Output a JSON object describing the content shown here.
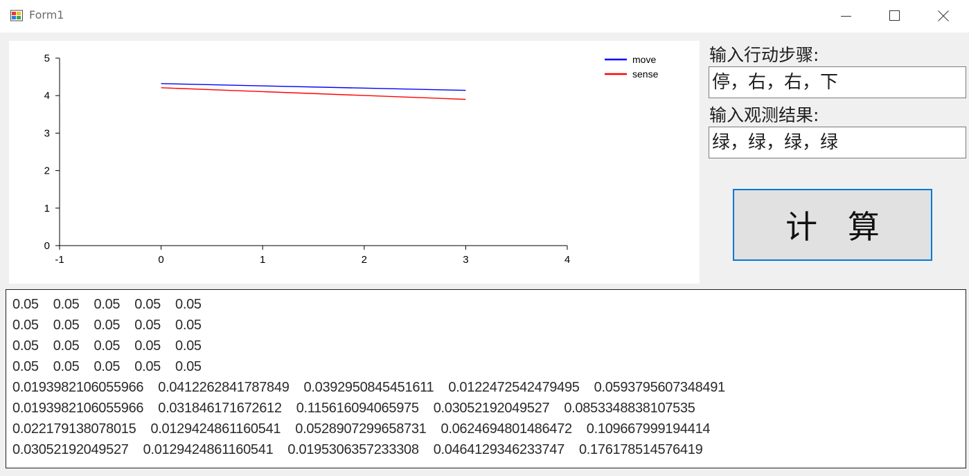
{
  "window": {
    "title": "Form1"
  },
  "labels": {
    "actions_label": "输入行动步骤:",
    "observations_label": "输入观测结果:"
  },
  "inputs": {
    "actions_value": "停，右，右，下",
    "observations_value": "绿，绿，绿，绿"
  },
  "buttons": {
    "calculate_label": "计   算"
  },
  "output_lines": [
    "0.05    0.05    0.05    0.05    0.05",
    "0.05    0.05    0.05    0.05    0.05",
    "0.05    0.05    0.05    0.05    0.05",
    "0.05    0.05    0.05    0.05    0.05",
    "0.0193982106055966    0.0412262841787849    0.0392950845451611    0.0122472542479495    0.0593795607348491",
    "0.0193982106055966    0.031846171672612    0.115616094065975    0.03052192049527    0.0853348838107535",
    "0.022179138078015    0.0129424861160541    0.0528907299658731    0.0624694801486472    0.109667999194414",
    "0.03052192049527    0.0129424861160541    0.0195306357233308    0.0464129346233747    0.176178514576419"
  ],
  "chart_data": {
    "type": "line",
    "xlim": [
      -1,
      4
    ],
    "ylim": [
      0,
      5
    ],
    "x_ticks": [
      "-1",
      "0",
      "1",
      "2",
      "3",
      "4"
    ],
    "y_ticks": [
      "0",
      "1",
      "2",
      "3",
      "4",
      "5"
    ],
    "x": [
      0,
      3
    ],
    "series": [
      {
        "name": "move",
        "color": "#0000ff",
        "values": [
          4.32,
          4.14
        ]
      },
      {
        "name": "sense",
        "color": "#ff0000",
        "values": [
          4.21,
          3.9
        ]
      }
    ],
    "legend_position": "top-right",
    "grid": false
  }
}
